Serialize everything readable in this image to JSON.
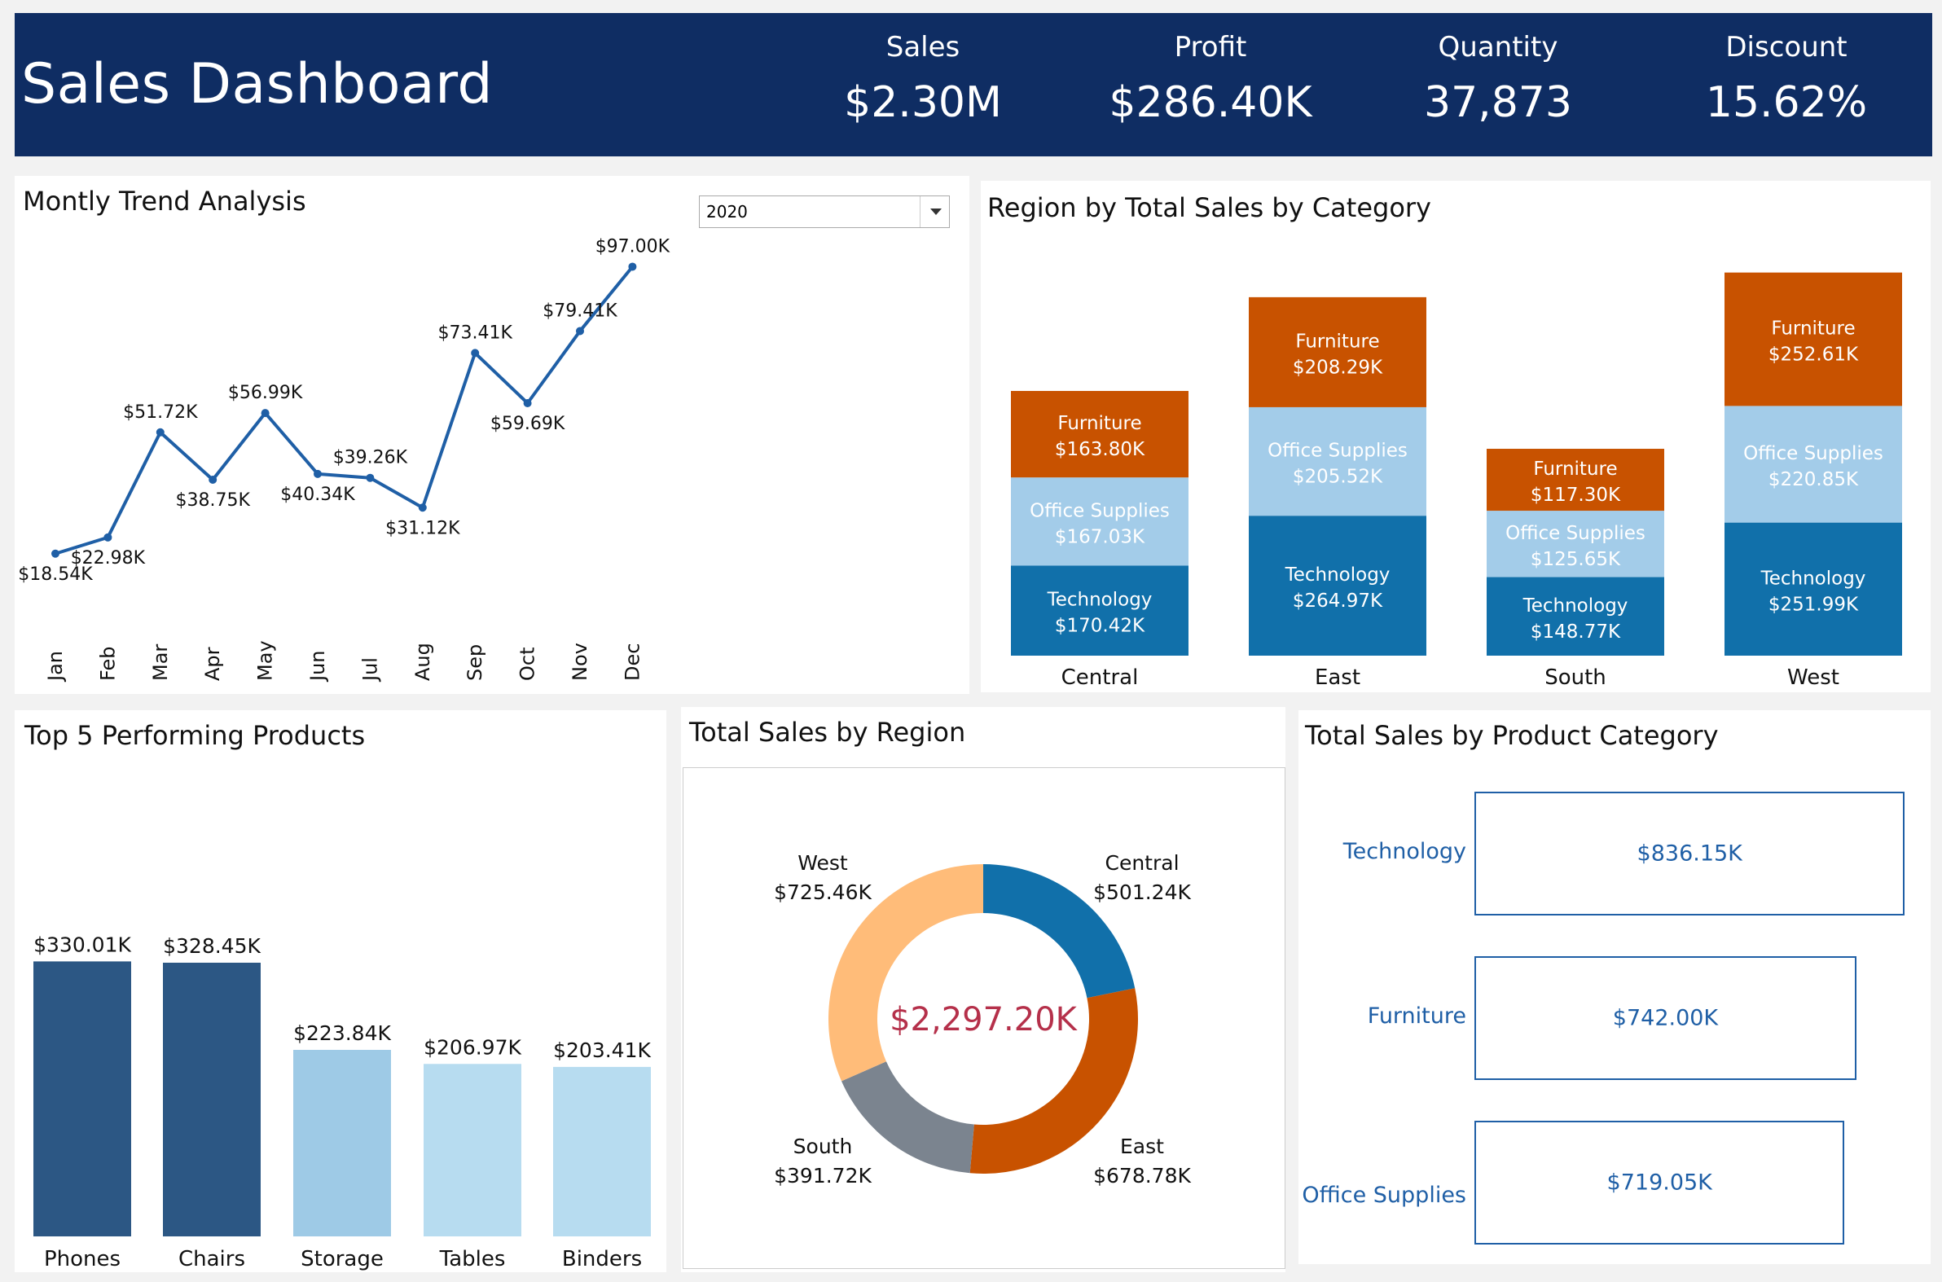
{
  "header": {
    "title": "Sales Dashboard",
    "kpis": [
      {
        "label": "Sales",
        "value": "$2.30M"
      },
      {
        "label": "Profit",
        "value": "$286.40K"
      },
      {
        "label": "Quantity",
        "value": "37,873"
      },
      {
        "label": "Discount",
        "value": "15.62%"
      }
    ]
  },
  "colors": {
    "header_bg": "#0f2d63",
    "line": "#1f5fa6",
    "furniture": "#c85200",
    "office_supplies": "#a3cce9",
    "technology": "#1170aa",
    "donut_west": "#ffbc79",
    "donut_central": "#1170aa",
    "donut_east": "#c85200",
    "donut_south": "#7b848f",
    "center_text": "#b5304a",
    "top_dark": "#2c5784",
    "top_mid": "#9ecae6",
    "top_light": "#b7dcf0"
  },
  "trend": {
    "title": "Montly Trend Analysis",
    "filter": {
      "selected": "2020"
    }
  },
  "stacked": {
    "title": "Region by Total Sales by Category"
  },
  "top5": {
    "title": "Top 5 Performing Products"
  },
  "donut": {
    "title": "Total Sales by Region",
    "center_label": "$2,297.20K"
  },
  "category": {
    "title": "Total Sales by Product Category"
  },
  "chart_data": [
    {
      "type": "line",
      "title": "Montly Trend Analysis",
      "categories": [
        "Jan",
        "Feb",
        "Mar",
        "Apr",
        "May",
        "Jun",
        "Jul",
        "Aug",
        "Sep",
        "Oct",
        "Nov",
        "Dec"
      ],
      "values": [
        18.54,
        22.98,
        51.72,
        38.75,
        56.99,
        40.34,
        39.26,
        31.12,
        73.41,
        59.69,
        79.41,
        97.0
      ],
      "labels": [
        "$18.54K",
        "$22.98K",
        "$51.72K",
        "$38.75K",
        "$56.99K",
        "$40.34K",
        "$39.26K",
        "$31.12K",
        "$73.41K",
        "$59.69K",
        "$79.41K",
        "$97.00K"
      ],
      "unit": "$K",
      "ylim": [
        0,
        100
      ],
      "grid": false
    },
    {
      "type": "bar",
      "stacked": true,
      "title": "Region by Total Sales by Category",
      "categories": [
        "Central",
        "East",
        "South",
        "West"
      ],
      "series": [
        {
          "name": "Technology",
          "values": [
            170.42,
            264.97,
            148.77,
            251.99
          ],
          "labels": [
            "$170.42K",
            "$264.97K",
            "$148.77K",
            "$251.99K"
          ]
        },
        {
          "name": "Office Supplies",
          "values": [
            167.03,
            205.52,
            125.65,
            220.85
          ],
          "labels": [
            "$167.03K",
            "$205.52K",
            "$125.65K",
            "$220.85K"
          ]
        },
        {
          "name": "Furniture",
          "values": [
            163.8,
            208.29,
            117.3,
            252.61
          ],
          "labels": [
            "$163.80K",
            "$208.29K",
            "$117.30K",
            "$252.61K"
          ]
        }
      ],
      "unit": "$K",
      "grid": false
    },
    {
      "type": "bar",
      "title": "Top 5 Performing Products",
      "categories": [
        "Phones",
        "Chairs",
        "Storage",
        "Tables",
        "Binders"
      ],
      "values": [
        330.01,
        328.45,
        223.84,
        206.97,
        203.41
      ],
      "labels": [
        "$330.01K",
        "$328.45K",
        "$223.84K",
        "$206.97K",
        "$203.41K"
      ],
      "unit": "$K",
      "grid": false
    },
    {
      "type": "pie",
      "donut": true,
      "title": "Total Sales by Region",
      "categories": [
        "Central",
        "East",
        "South",
        "West"
      ],
      "values": [
        501.24,
        678.78,
        391.72,
        725.46
      ],
      "labels": [
        "$501.24K",
        "$678.78K",
        "$391.72K",
        "$725.46K"
      ],
      "total_label": "$2,297.20K",
      "unit": "$K"
    },
    {
      "type": "bar",
      "orientation": "horizontal",
      "title": "Total Sales by Product Category",
      "categories": [
        "Technology",
        "Furniture",
        "Office Supplies"
      ],
      "values": [
        836.15,
        742.0,
        719.05
      ],
      "labels": [
        "$836.15K",
        "$742.00K",
        "$719.05K"
      ],
      "unit": "$K",
      "grid": false
    }
  ]
}
